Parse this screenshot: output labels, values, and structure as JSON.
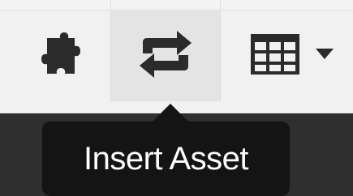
{
  "toolbar": {
    "buttons": [
      {
        "icon": "puzzle-piece-icon",
        "label": ""
      },
      {
        "icon": "swap-arrows-icon",
        "label": ""
      },
      {
        "icon": "table-grid-icon",
        "label": ""
      }
    ],
    "active_button": "insert-asset",
    "colors": {
      "icon": "#2b2b2b",
      "active_bg": "#e4e4e4",
      "toolbar_bg": "#f1f1f1"
    }
  },
  "tooltip": {
    "text": "Insert Asset",
    "bg_color": "#141414",
    "text_color": "#ffffff"
  }
}
